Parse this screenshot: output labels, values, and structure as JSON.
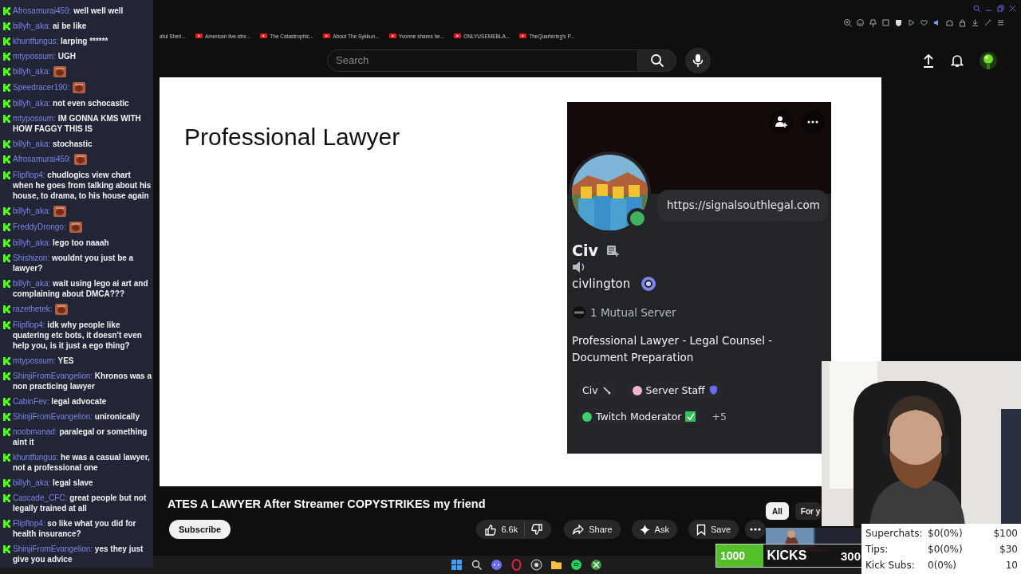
{
  "bookmarks": [
    "aful Sheri...",
    "American live-stre...",
    "The Catastrophic...",
    "About The Sykkun...",
    "Yvonne shares he...",
    "ONLYUSEMEBLA...",
    "TheQuartering's P..."
  ],
  "header": {
    "search": {
      "placeholder": "Search"
    }
  },
  "video": {
    "slide_title": "Professional Lawyer",
    "profile_card": {
      "status_bubble": "https://signalsouthlegal.com",
      "display_name": "Civ",
      "username": "civlington",
      "mutual": "1 Mutual Server",
      "bio": "Professional Lawyer - Legal Counsel - Document Preparation",
      "roles": [
        {
          "name": "Civ"
        },
        {
          "name": "Server Staff",
          "color": "#f2b6cf"
        },
        {
          "name": "Twitch Moderator",
          "color": "#3fcf6a"
        }
      ],
      "more_roles": "+5"
    }
  },
  "title": "ATES A LAWYER After Streamer COPYSTRIKES my friend",
  "actions": {
    "subscribe": "Subscribe",
    "likes": "6.6k",
    "share": "Share",
    "ask": "Ask",
    "save": "Save"
  },
  "chips": [
    {
      "label": "All",
      "selected": true
    },
    {
      "label": "For y",
      "selected": false
    }
  ],
  "chat": [
    {
      "user": "Afrosamurai459:",
      "kind": "text",
      "text": "well well well"
    },
    {
      "user": "billyh_aka:",
      "kind": "text",
      "text": "ai be like"
    },
    {
      "user": "khuntfungus:",
      "kind": "text",
      "text": "larping ******"
    },
    {
      "user": "mtypossum:",
      "kind": "text",
      "text": "UGH"
    },
    {
      "user": "billyh_aka:",
      "kind": "emote"
    },
    {
      "user": "Speedracer190:",
      "kind": "emote"
    },
    {
      "user": "billyh_aka:",
      "kind": "text",
      "text": "not even schocastic"
    },
    {
      "user": "mtypossum:",
      "kind": "text",
      "text": "IM GONNA KMS WITH HOW FAGGY THIS IS"
    },
    {
      "user": "billyh_aka:",
      "kind": "text",
      "text": "stochastic"
    },
    {
      "user": "Afrosamurai459:",
      "kind": "emote"
    },
    {
      "user": "Flipflop4:",
      "kind": "text",
      "text": "chudlogics view chart when he goes from talking about his house, to drama, to his house again"
    },
    {
      "user": "billyh_aka:",
      "kind": "emote"
    },
    {
      "user": "FreddyDrongo:",
      "kind": "emote"
    },
    {
      "user": "billyh_aka:",
      "kind": "text",
      "text": "lego too naaah"
    },
    {
      "user": "Shishizon:",
      "kind": "text",
      "text": "wouldnt you just be a lawyer?"
    },
    {
      "user": "billyh_aka:",
      "kind": "text",
      "text": "wait using lego ai art and complaining about DMCA???"
    },
    {
      "user": "razethetek:",
      "kind": "emote"
    },
    {
      "user": "Flipflop4:",
      "kind": "text",
      "text": "idk why people like quatering etc bots, it doesn't even help you, is it just a ego thing?"
    },
    {
      "user": "mtypossum:",
      "kind": "text",
      "text": "YES"
    },
    {
      "user": "ShinjiFromEvangelion:",
      "kind": "text",
      "text": "Khronos was a non practicing lawyer"
    },
    {
      "user": "CabinFev:",
      "kind": "text",
      "text": "legal advocate"
    },
    {
      "user": "ShinjiFromEvangelion:",
      "kind": "text",
      "text": "unironically"
    },
    {
      "user": "noobmanad:",
      "kind": "text",
      "text": "paralegal or something aint it"
    },
    {
      "user": "khuntfungus:",
      "kind": "text",
      "text": "he was a casual lawyer, not a professional one"
    },
    {
      "user": "billyh_aka:",
      "kind": "text",
      "text": "legal slave"
    },
    {
      "user": "Cascade_CFC:",
      "kind": "text",
      "text": "great people but not legally trained at all"
    },
    {
      "user": "Flipflop4:",
      "kind": "text",
      "text": "so like what you did for health insurance?"
    },
    {
      "user": "ShinjiFromEvangelion:",
      "kind": "text",
      "text": "yes they just give you advice"
    }
  ],
  "kick_goal": {
    "level": 0.32,
    "current": "1000",
    "label": "KICKS",
    "target": "300"
  },
  "stats": [
    {
      "label": "Superchats:",
      "value": "$0(0%)",
      "goal": "$100"
    },
    {
      "label": "Tips:",
      "value": "$0(0%)",
      "goal": "$30"
    },
    {
      "label": "Kick Subs:",
      "value": "0(0%)",
      "goal": "10"
    }
  ]
}
